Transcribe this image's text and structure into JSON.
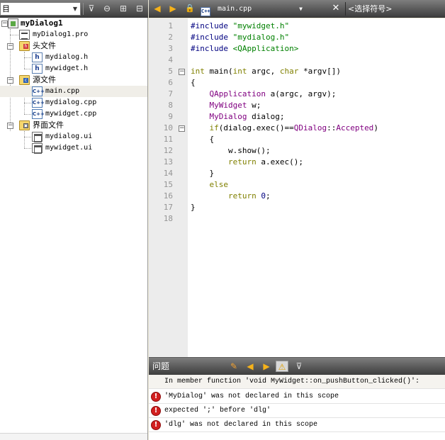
{
  "sidebar": {
    "view_label": "目",
    "tree": {
      "project": "myDialog1",
      "pro_file": "myDialog1.pro",
      "headers_folder": "头文件",
      "headers": [
        "mydialog.h",
        "mywidget.h"
      ],
      "sources_folder": "源文件",
      "sources": [
        "main.cpp",
        "mydialog.cpp",
        "mywidget.cpp"
      ],
      "forms_folder": "界面文件",
      "forms": [
        "mydialog.ui",
        "mywidget.ui"
      ],
      "selected": "main.cpp"
    }
  },
  "editor": {
    "file_name": "main.cpp",
    "symbol_placeholder": "<选择符号>",
    "line_numbers": [
      "1",
      "2",
      "3",
      "4",
      "5",
      "6",
      "7",
      "8",
      "9",
      "10",
      "11",
      "12",
      "13",
      "14",
      "15",
      "16",
      "17",
      "18"
    ],
    "code": {
      "l1_a": "#include ",
      "l1_b": "\"mywidget.h\"",
      "l2_a": "#include ",
      "l2_b": "\"mydialog.h\"",
      "l3_a": "#include ",
      "l3_b": "<QApplication>",
      "l5_a": "int",
      "l5_b": " main(",
      "l5_c": "int",
      "l5_d": " argc, ",
      "l5_e": "char",
      "l5_f": " *argv[])",
      "l6": "{",
      "l7_a": "    ",
      "l7_b": "QApplication",
      "l7_c": " a(argc, argv);",
      "l8_a": "    ",
      "l8_b": "MyWidget",
      "l8_c": " w;",
      "l9_a": "    ",
      "l9_b": "MyDialog",
      "l9_c": " dialog;",
      "l10_a": "    ",
      "l10_b": "if",
      "l10_c": "(dialog.exec()==",
      "l10_d": "QDialog",
      "l10_e": "::",
      "l10_f": "Accepted",
      "l10_g": ")",
      "l11": "    {",
      "l12": "        w.show();",
      "l13_a": "        ",
      "l13_b": "return",
      "l13_c": " a.exec();",
      "l14": "    }",
      "l15_a": "    ",
      "l15_b": "else",
      "l16_a": "        ",
      "l16_b": "return",
      "l16_c": " ",
      "l16_d": "0",
      "l16_e": ";",
      "l17": "}"
    }
  },
  "issues": {
    "title": "问题",
    "context": "In member function 'void MyWidget::on_pushButton_clicked()':",
    "errors": [
      "'MyDialog' was not declared in this scope",
      "expected ';' before 'dlg'",
      "'dlg' was not declared in this scope"
    ],
    "error_icon": "!"
  },
  "colors": {
    "preprocessor": "#000080",
    "string": "#008000",
    "keyword": "#808000",
    "type": "#800080"
  }
}
